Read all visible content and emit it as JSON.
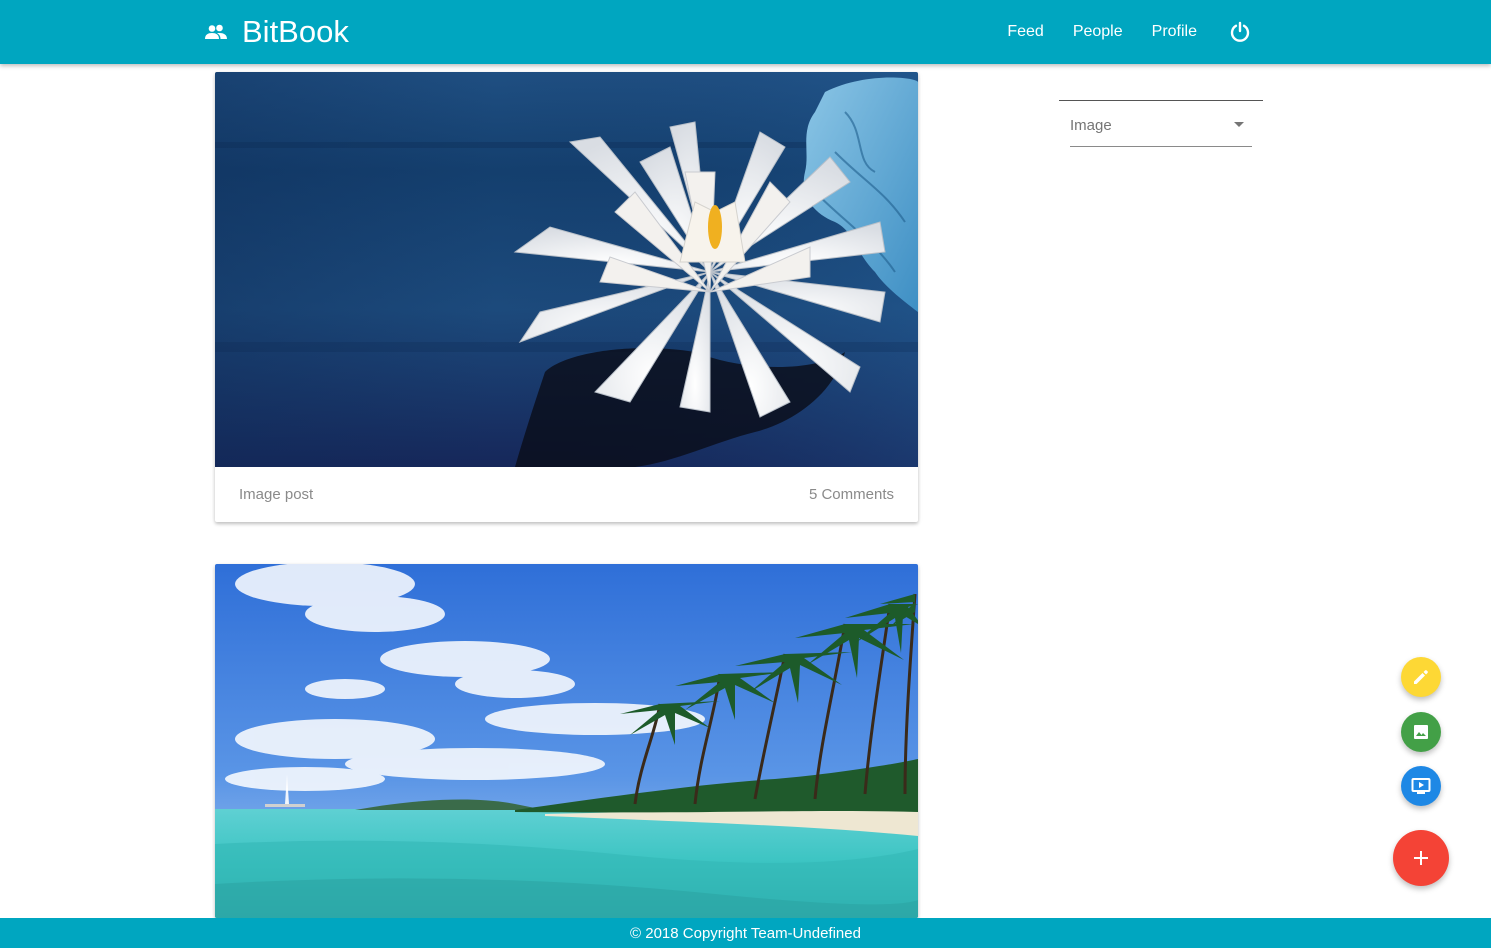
{
  "app": {
    "name": "BitBook"
  },
  "nav": {
    "links": [
      "Feed",
      "People",
      "Profile"
    ],
    "logout_icon": "power-icon",
    "brand_icon": "people-icon"
  },
  "posts": [
    {
      "type_label": "Image post",
      "comments": "5 Comments",
      "image": "white-water-lily"
    },
    {
      "image": "tropical-beach-palms"
    }
  ],
  "filter": {
    "value": "Image"
  },
  "fabs": {
    "text_post": "pencil-icon",
    "image_post": "image-icon",
    "video_post": "video-icon",
    "main": "plus-icon"
  },
  "colors": {
    "primary": "#00a6c0",
    "fab_yellow": "#fdd835",
    "fab_green": "#43a047",
    "fab_blue": "#1e88e5",
    "fab_red": "#f44336"
  },
  "footer": {
    "copyright": "© 2018 Copyright Team-Undefined"
  }
}
